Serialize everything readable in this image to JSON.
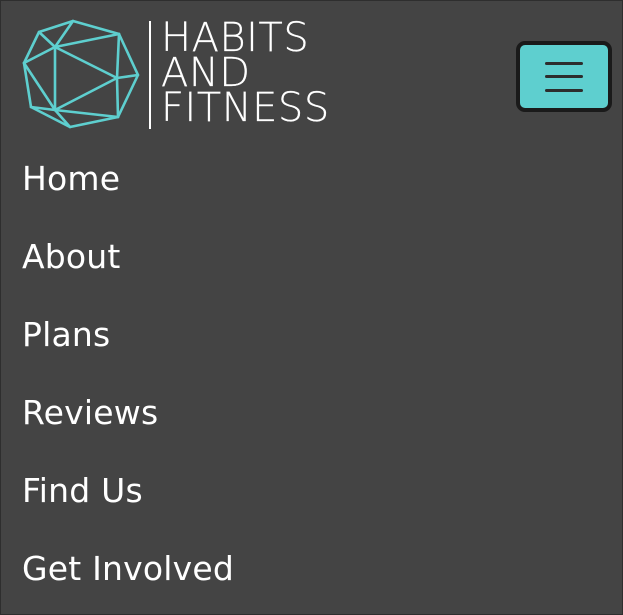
{
  "brand": {
    "lines": [
      "HABITS",
      "AND",
      "FITNESS"
    ],
    "logo_icon": "hexagon-dice-icon"
  },
  "menu_toggle": {
    "icon": "hamburger-icon"
  },
  "nav": {
    "items": [
      {
        "label": "Home"
      },
      {
        "label": "About"
      },
      {
        "label": "Plans"
      },
      {
        "label": "Reviews"
      },
      {
        "label": "Find Us"
      },
      {
        "label": "Get Involved"
      }
    ]
  },
  "colors": {
    "background": "#444444",
    "accent": "#5ecfcf",
    "text": "#ffffff"
  }
}
